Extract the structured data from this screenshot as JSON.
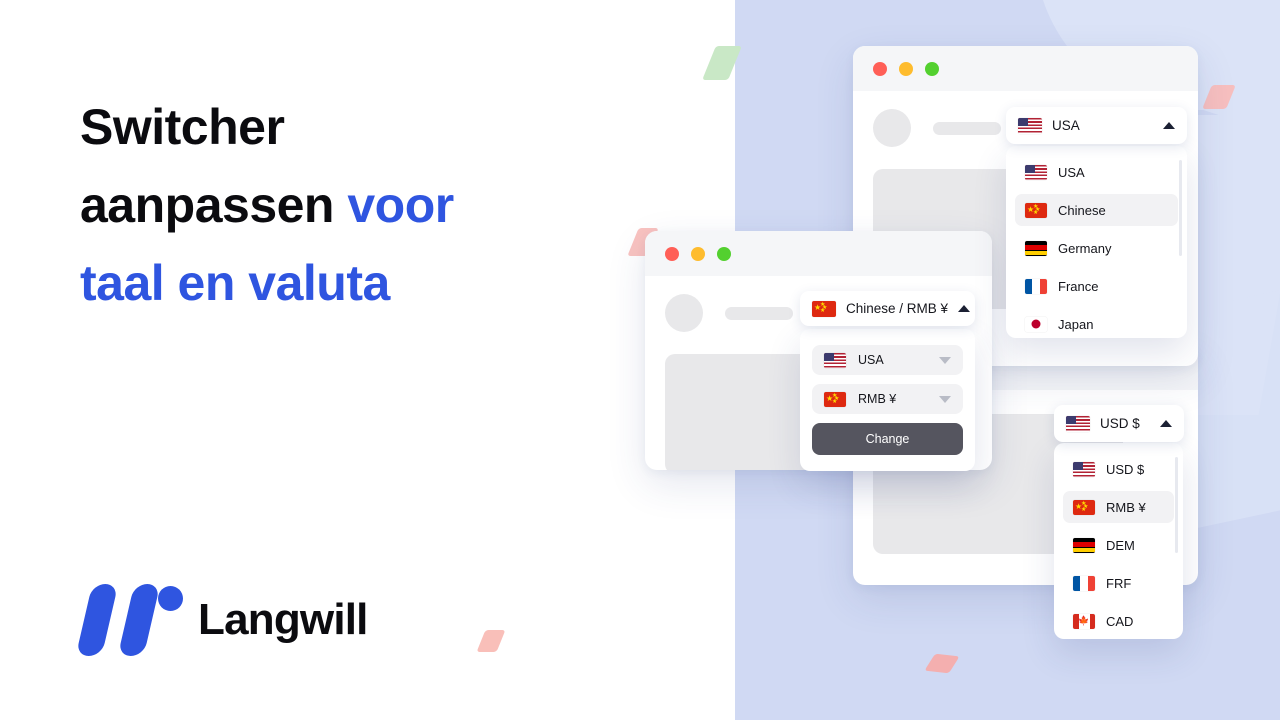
{
  "brand": {
    "name": "Langwill",
    "accent_color": "#2f55e0",
    "logo_icon": "w-logo-icon"
  },
  "headline": {
    "line1": "Switcher",
    "line2_black": "aanpassen ",
    "line2_accent": "voor",
    "line3_accent": "taal en valuta"
  },
  "background": {
    "panel_color": "#d0d9f3",
    "shape_color": "#dbe3f7",
    "decorations": [
      {
        "name": "green-parallelogram",
        "color": "#c9e8c6"
      },
      {
        "name": "pink-parallelogram-top",
        "color": "#f7bfbf"
      },
      {
        "name": "pink-parallelogram-left",
        "color": "#f9c3c0"
      },
      {
        "name": "pink-parallelogram-white",
        "color": "#f9bfb9"
      },
      {
        "name": "pink-diamond-bottom",
        "color": "#f4afaf"
      }
    ]
  },
  "window_language": {
    "traffic_lights": [
      "close",
      "minimize",
      "maximize"
    ],
    "trigger": {
      "label": "USA",
      "flag": "usa",
      "caret": "caret-up-icon"
    },
    "items": [
      {
        "label": "USA",
        "flag": "usa",
        "active": false
      },
      {
        "label": "Chinese",
        "flag": "cn",
        "active": true
      },
      {
        "label": "Germany",
        "flag": "de",
        "active": false
      },
      {
        "label": "France",
        "flag": "fr",
        "active": false
      },
      {
        "label": "Japan",
        "flag": "jp",
        "active": false
      }
    ]
  },
  "window_currency": {
    "trigger": {
      "label": "USD $",
      "flag": "usa",
      "caret": "caret-up-icon"
    },
    "items": [
      {
        "label": "USD $",
        "flag": "usa",
        "active": false
      },
      {
        "label": "RMB ¥",
        "flag": "cn",
        "active": true
      },
      {
        "label": "DEM",
        "flag": "de",
        "active": false
      },
      {
        "label": "FRF",
        "flag": "fr",
        "active": false
      },
      {
        "label": "CAD",
        "flag": "ca",
        "active": false
      }
    ]
  },
  "window_switcher": {
    "traffic_lights": [
      "close",
      "minimize",
      "maximize"
    ],
    "trigger": {
      "label": "Chinese / RMB ¥",
      "flag": "cn",
      "caret": "caret-up-icon"
    },
    "selects": [
      {
        "label": "USA",
        "flag": "usa",
        "caret": "caret-down-icon"
      },
      {
        "label": "RMB ¥",
        "flag": "cn",
        "caret": "caret-down-icon"
      }
    ],
    "change_button": "Change"
  }
}
